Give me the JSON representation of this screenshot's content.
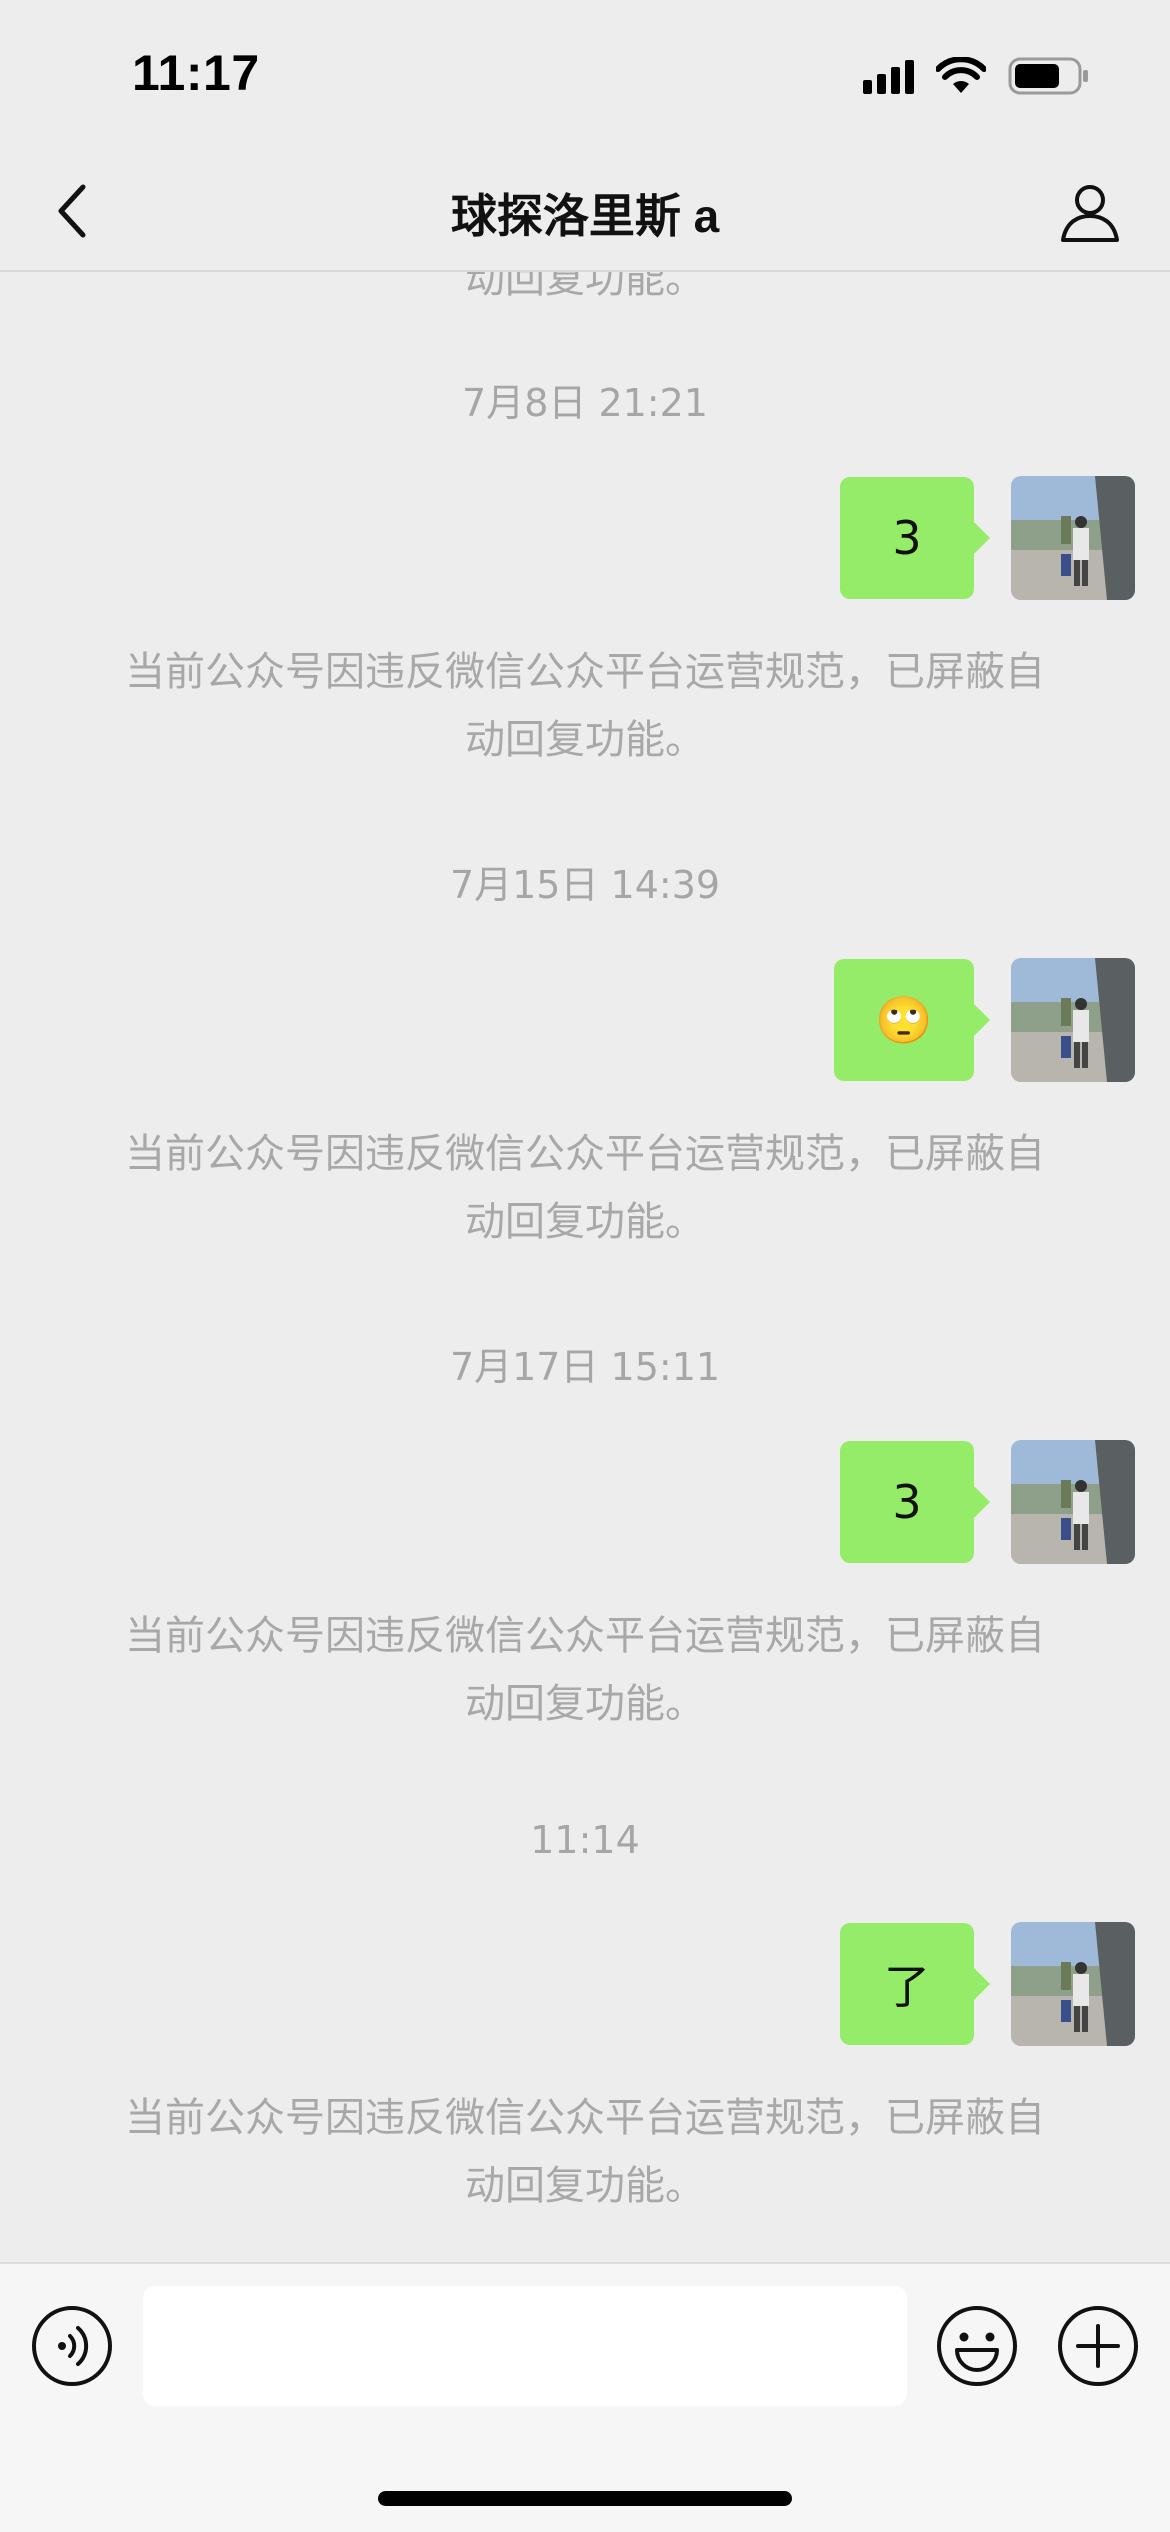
{
  "status_bar": {
    "time": "11:17"
  },
  "nav": {
    "title": "球探洛里斯 a"
  },
  "chat": {
    "clipped_notice": "动回复功能。",
    "messages": [
      {
        "timestamp": "7月8日 21:21",
        "text": "3",
        "notice_line1": "当前公众号因违反微信公众平台运营规范，已屏蔽自",
        "notice_line2": "动回复功能。"
      },
      {
        "timestamp": "7月15日 14:39",
        "text": "🙄",
        "notice_line1": "当前公众号因违反微信公众平台运营规范，已屏蔽自",
        "notice_line2": "动回复功能。"
      },
      {
        "timestamp": "7月17日 15:11",
        "text": "3",
        "notice_line1": "当前公众号因违反微信公众平台运营规范，已屏蔽自",
        "notice_line2": "动回复功能。"
      },
      {
        "timestamp": "11:14",
        "text": "了",
        "notice_line1": "当前公众号因违反微信公众平台运营规范，已屏蔽自",
        "notice_line2": "动回复功能。"
      }
    ]
  },
  "input_bar": {
    "value": ""
  },
  "icons": {
    "back": "chevron-left-icon",
    "profile": "person-icon",
    "voice": "voice-icon",
    "emoji": "smiley-icon",
    "plus": "plus-icon"
  },
  "colors": {
    "bubble": "#95ec69",
    "background": "#ededed",
    "notice_text": "#a8a8a8"
  }
}
